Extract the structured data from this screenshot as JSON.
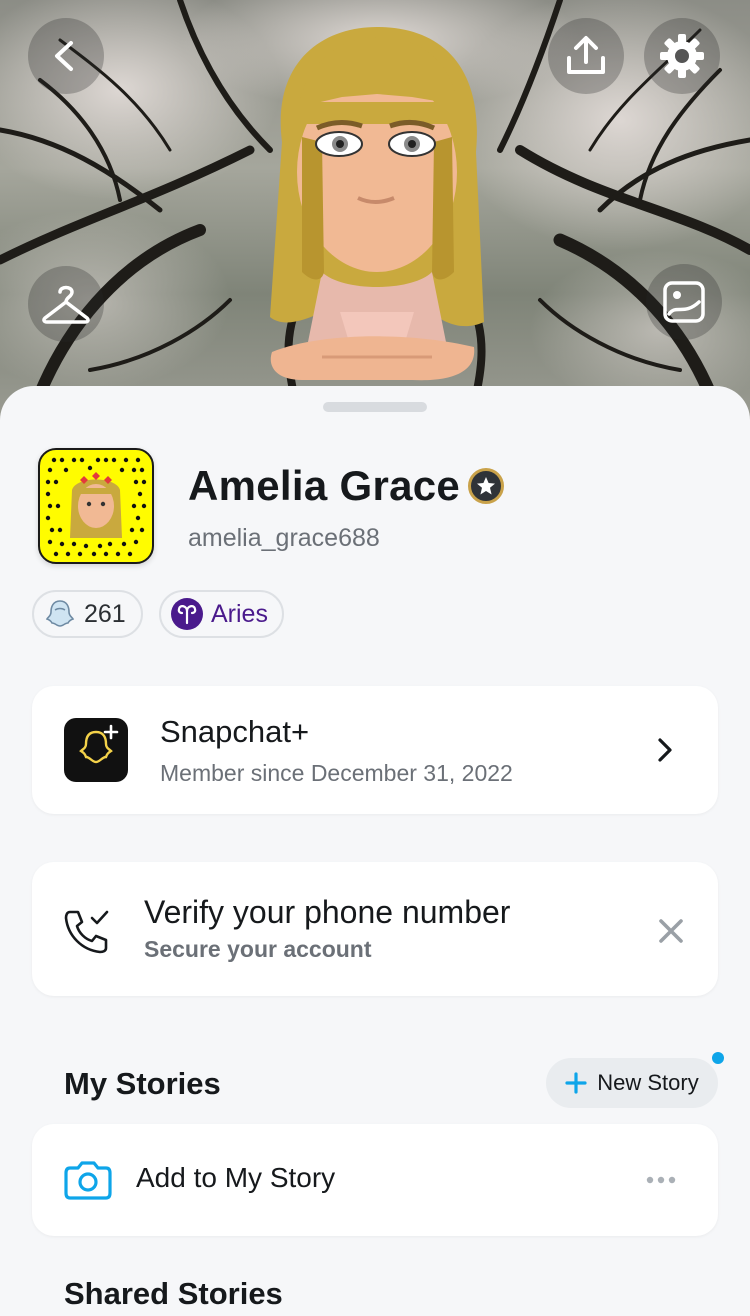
{
  "header": {
    "back_icon": "chevron-left-icon",
    "share_icon": "upload-icon",
    "settings_icon": "gear-icon",
    "outfit_icon": "hanger-icon",
    "background_icon": "image-icon"
  },
  "profile": {
    "display_name": "Amelia Grace",
    "username": "amelia_grace688",
    "badge_icon": "star-icon"
  },
  "chips": {
    "friends_count": "261",
    "zodiac": "Aries"
  },
  "snapchat_plus": {
    "title": "Snapchat+",
    "subtitle": "Member since December 31, 2022"
  },
  "verify": {
    "title": "Verify your phone number",
    "subtitle": "Secure your account"
  },
  "my_stories": {
    "title": "My Stories",
    "new_story_label": "New Story",
    "add_label": "Add to My Story"
  },
  "shared_stories": {
    "title": "Shared Stories"
  },
  "colors": {
    "snapcode_yellow": "#fffc00",
    "zodiac_purple": "#4a1a8c",
    "accent_blue": "#0ea5e9"
  }
}
